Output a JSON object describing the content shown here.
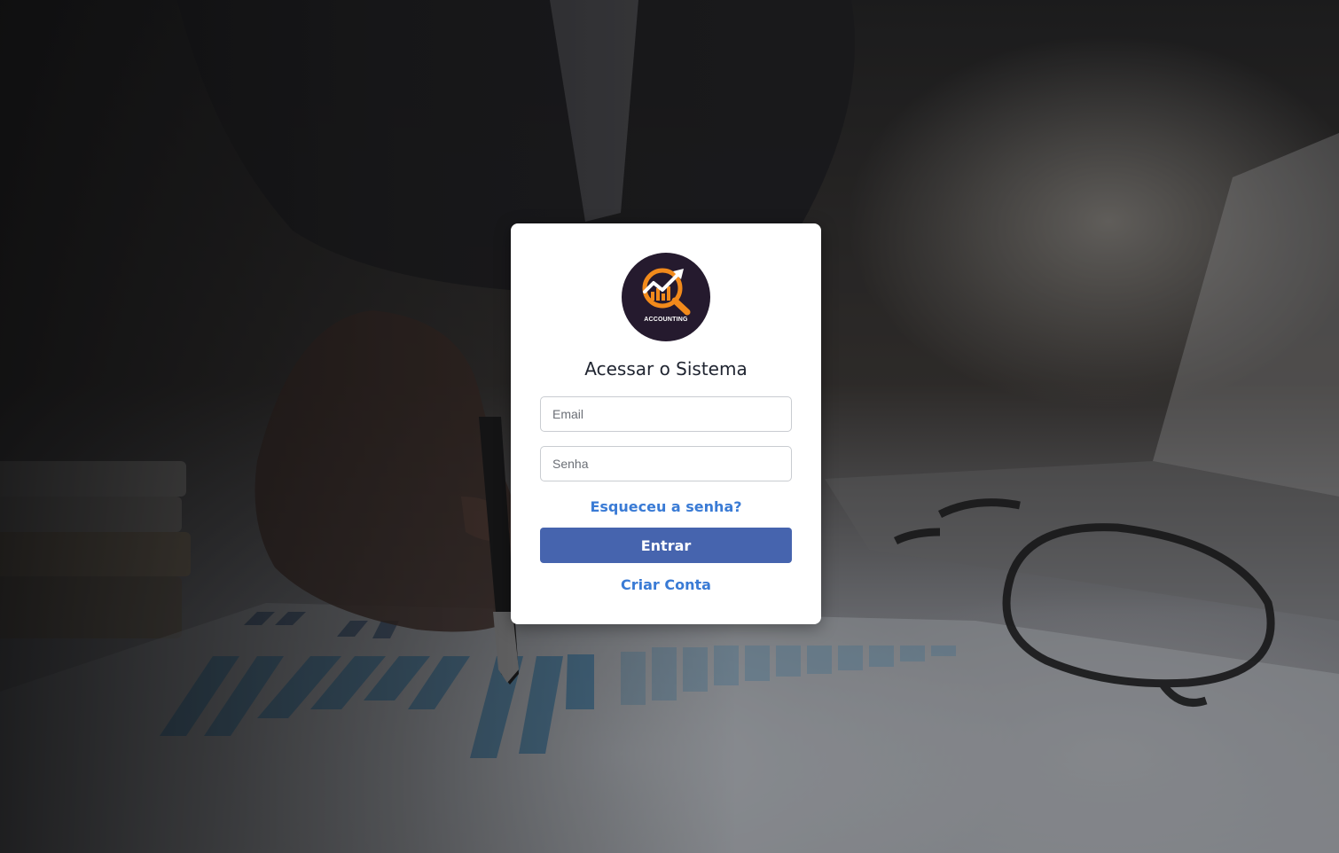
{
  "brand": {
    "logo_text": "ACCOUNTING"
  },
  "login": {
    "title": "Acessar o Sistema",
    "email_placeholder": "Email",
    "password_placeholder": "Senha",
    "forgot_label": "Esqueceu a senha?",
    "submit_label": "Entrar",
    "create_label": "Criar Conta"
  },
  "colors": {
    "primary_button": "#4664ae",
    "link": "#3a7bd5",
    "logo_bg": "#251a2e",
    "logo_accent": "#f28a1b"
  }
}
